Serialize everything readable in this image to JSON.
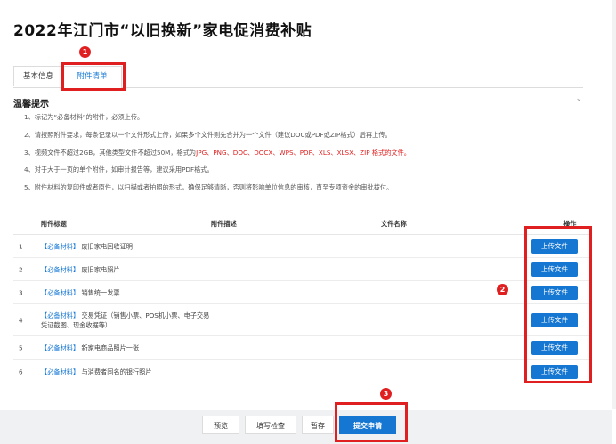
{
  "page": {
    "title": "2022年江门市“以旧换新”家电促消费补贴"
  },
  "tabs": [
    {
      "label": "基本信息"
    },
    {
      "label": "附件清单"
    }
  ],
  "tips": {
    "title": "温馨提示",
    "items": [
      {
        "text": "1、标记为“必备材料”的附件，必须上传。"
      },
      {
        "text": "2、请按照附件要求，每条记录以一个文件形式上传，如果多个文件则先合并为一个文件（建议DOC或PDF或ZIP格式）后再上传。"
      },
      {
        "text": "3、视频文件不超过2GB，其他类型文件不超过50M，格式为",
        "red": "JPG、PNG、DOC、DOCX、WPS、PDF、XLS、XLSX、ZIP 格式的文件。"
      },
      {
        "text": "4、对于大于一页的单个附件，如审计报告等，建议采用PDF格式。"
      },
      {
        "text": "5、附件材料的复印件或者原件，以扫描或者拍照的形式，确保足够清晰，否则将影响单位信息的审核，直至专项资金的审批拨付。"
      }
    ]
  },
  "table": {
    "headers": {
      "title": "附件标题",
      "desc": "附件描述",
      "filename": "文件名称",
      "action": "操作"
    },
    "rows": [
      {
        "index": "1",
        "tag": "【必备材料】",
        "name": "废旧家电回收证明",
        "name2": "",
        "action": "上传文件"
      },
      {
        "index": "2",
        "tag": "【必备材料】",
        "name": "废旧家电照片",
        "name2": "",
        "action": "上传文件"
      },
      {
        "index": "3",
        "tag": "【必备材料】",
        "name": "销售统一发票",
        "name2": "",
        "action": "上传文件"
      },
      {
        "index": "4",
        "tag": "【必备材料】",
        "name": "交易凭证（销售小票、POS机小票、电子交易",
        "name2": "凭证截图、现金收据等）",
        "action": "上传文件"
      },
      {
        "index": "5",
        "tag": "【必备材料】",
        "name": "新家电商品照片一张",
        "name2": "",
        "action": "上传文件"
      },
      {
        "index": "6",
        "tag": "【必备材料】",
        "name": "与消费者同名的银行照片",
        "name2": "",
        "action": "上传文件"
      }
    ]
  },
  "annotations": {
    "one": "1",
    "two": "2",
    "three": "3"
  },
  "footer": {
    "preview": "预览",
    "check": "填写检查",
    "save": "暂存",
    "submit": "提交申请"
  }
}
